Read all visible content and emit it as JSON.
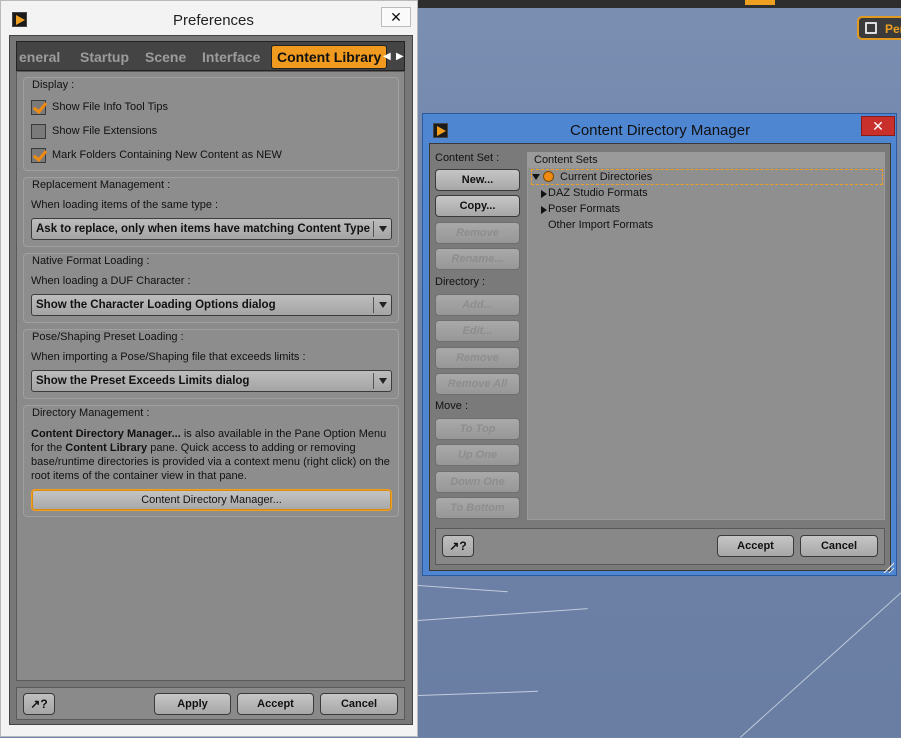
{
  "preferences": {
    "title": "Preferences",
    "close_glyph": "✕",
    "tabs": [
      {
        "label": "eneral",
        "active": false
      },
      {
        "label": "Startup",
        "active": false
      },
      {
        "label": "Scene",
        "active": false
      },
      {
        "label": "Interface",
        "active": false
      },
      {
        "label": "Content Library",
        "active": true
      }
    ],
    "tab_scroll_left": "◀",
    "tab_scroll_right": "▶",
    "display": {
      "title": "Display :",
      "options": [
        {
          "label": "Show File Info Tool Tips",
          "checked": true
        },
        {
          "label": "Show File Extensions",
          "checked": false
        },
        {
          "label": "Mark Folders Containing New Content as NEW",
          "checked": true
        }
      ]
    },
    "replacement": {
      "title": "Replacement Management :",
      "prompt": "When loading items of the same type :",
      "selected": "Ask to replace, only when items have matching Content Type"
    },
    "native_format": {
      "title": "Native Format Loading :",
      "prompt": "When loading a DUF Character :",
      "selected": "Show the Character Loading Options dialog"
    },
    "pose_shaping": {
      "title": "Pose/Shaping Preset Loading :",
      "prompt": "When importing a Pose/Shaping file that exceeds limits :",
      "selected": "Show the Preset Exceeds Limits dialog"
    },
    "directory_management": {
      "title": "Directory Management :",
      "desc_bold_1": "Content Directory Manager...",
      "desc_1": " is also available in the Pane Option Menu for the ",
      "desc_bold_2": "Content Library",
      "desc_2": " pane. Quick access to adding or removing base/runtime directories is provided via a context menu (right click) on the root items of the container view in that pane.",
      "button": "Content Directory Manager..."
    },
    "footer": {
      "help": "↗?",
      "apply": "Apply",
      "accept": "Accept",
      "cancel": "Cancel"
    }
  },
  "cdm": {
    "title": "Content Directory Manager",
    "close_glyph": "✕",
    "content_set_label": "Content Set :",
    "content_set_buttons": [
      {
        "label": "New...",
        "enabled": true
      },
      {
        "label": "Copy...",
        "enabled": true
      },
      {
        "label": "Remove",
        "enabled": false
      },
      {
        "label": "Rename...",
        "enabled": false
      }
    ],
    "directory_label": "Directory :",
    "directory_buttons": [
      {
        "label": "Add...",
        "enabled": false
      },
      {
        "label": "Edit...",
        "enabled": false
      },
      {
        "label": "Remove",
        "enabled": false
      },
      {
        "label": "Remove All",
        "enabled": false
      }
    ],
    "move_label": "Move :",
    "move_buttons": [
      {
        "label": "To Top",
        "enabled": false
      },
      {
        "label": "Up One",
        "enabled": false
      },
      {
        "label": "Down One",
        "enabled": false
      },
      {
        "label": "To Bottom",
        "enabled": false
      }
    ],
    "tree_header": "Content Sets",
    "tree": [
      {
        "label": "Current Directories",
        "expanded": true,
        "selected": true
      },
      {
        "label": "DAZ Studio Formats",
        "expanded": false
      },
      {
        "label": "Poser Formats",
        "expanded": false
      },
      {
        "label": "Other Import Formats",
        "expanded": null
      }
    ],
    "footer": {
      "help": "↗?",
      "accept": "Accept",
      "cancel": "Cancel"
    }
  },
  "viewport": {
    "camera_button": "Per"
  },
  "colors": {
    "accent": "#f09a20",
    "panel": "#8d8d8d",
    "viewport": "#6f84a8",
    "cdm_frame": "#4f86d1"
  }
}
